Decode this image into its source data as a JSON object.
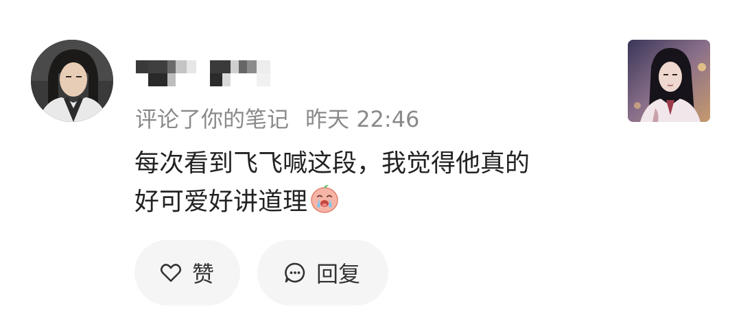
{
  "notification": {
    "meta_action": "评论了你的笔记",
    "meta_time": "昨天 22:46",
    "comment_line1": "每次看到飞飞喊这段，我觉得他真的",
    "comment_line2": "好可爱好讲道理",
    "emoji_icon": "crying-face-emoji"
  },
  "actions": {
    "like_label": "赞",
    "reply_label": "回复"
  },
  "colors": {
    "meta_text": "#8a8a8a",
    "body_text": "#222222",
    "button_bg": "#f5f5f5"
  }
}
